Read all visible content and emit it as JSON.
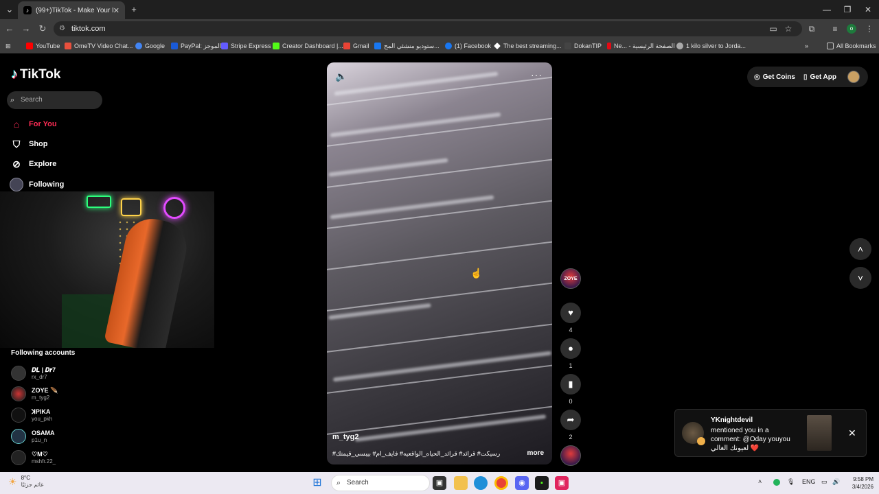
{
  "browser": {
    "tab_title": "(99+)TikTok - Make Your Day",
    "tab_close": "✕",
    "new_tab": "+",
    "url": "tiktok.com",
    "profile_initial": "o"
  },
  "bookmarks": [
    {
      "label": "YouTube",
      "color": "#ff0000"
    },
    {
      "label": "OmeTV Video Chat...",
      "color": "#e9503d"
    },
    {
      "label": "Google",
      "color": "#4285f4"
    },
    {
      "label": "PayPal: الموجز",
      "color": "#1a5ad7"
    },
    {
      "label": "Stripe Express",
      "color": "#635bff"
    },
    {
      "label": "Creator Dashboard |...",
      "color": "#53fc18"
    },
    {
      "label": "Gmail",
      "color": "#ea4335"
    },
    {
      "label": "ستوديو منشئي المح...",
      "color": "#1877f2"
    },
    {
      "label": "(1) Facebook",
      "color": "#1877f2"
    },
    {
      "label": "The best streaming...",
      "color": "#ffffff"
    },
    {
      "label": "DokanTIP",
      "color": "#444444"
    },
    {
      "label": "Ne... - الصفحة الرئيسية",
      "color": "#e50914"
    },
    {
      "label": "1 kilo silver to Jorda...",
      "color": "#aaaaaa"
    }
  ],
  "all_bookmarks": "All Bookmarks",
  "sidebar": {
    "logo": "TikTok",
    "search_placeholder": "Search",
    "nav": [
      {
        "label": "For You"
      },
      {
        "label": "Shop"
      },
      {
        "label": "Explore"
      },
      {
        "label": "Following"
      }
    ],
    "following_title": "Following accounts",
    "accounts": [
      {
        "name": "𝑫𝑳 | 𝑫𝒓7",
        "handle": "rx_dr7"
      },
      {
        "name": "ZOYE 🪶",
        "handle": "m_tyg2"
      },
      {
        "name": "ꓘPIKA",
        "handle": "you_pkh"
      },
      {
        "name": "OSAMA",
        "handle": "p1u_n"
      },
      {
        "name": "♡M♡",
        "handle": "mshfr.22_"
      }
    ]
  },
  "video": {
    "username": "m_tyg2",
    "caption": "رسيكت# قرائد# قرائد_الحياه_الواقعيه# فايف_ام# بيبسي_قيمتك#",
    "more": "more"
  },
  "actions": {
    "likes": "4",
    "comments": "1",
    "saves": "0",
    "shares": "2",
    "creator_avatar": "ZOYE"
  },
  "top_right": {
    "get_coins": "Get Coins",
    "get_app": "Get App"
  },
  "notification": {
    "user": "YKnightdevil",
    "message": "mentioned you in a comment: @Oday youyou لعيونك الغالي ❤️"
  },
  "taskbar": {
    "temperature": "8°C",
    "weather_desc": "غائم جزئيًا",
    "search": "Search",
    "lang": "ENG",
    "time": "9:58 PM",
    "date": "3/4/2026"
  }
}
